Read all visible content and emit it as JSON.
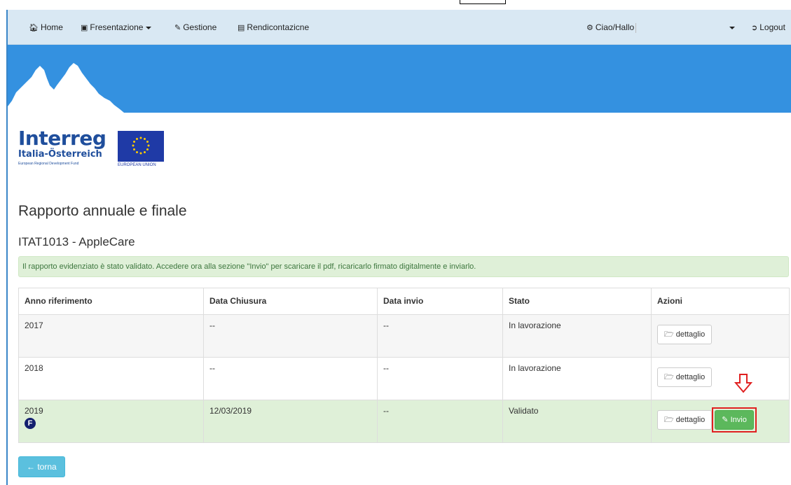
{
  "nav": {
    "home": "Home",
    "presentation": "Fresentazione",
    "management": "Gestione",
    "reporting": "Rendicontazicne",
    "user": "Ciao/Hallo",
    "logout": "Logout"
  },
  "logo": {
    "title": "Interreg",
    "subtitle": "Italia-Österreich",
    "fund": "European Regional Development Fund",
    "eu": "EUROPEAN UNION"
  },
  "page": {
    "title": "Rapporto annuale e finale",
    "project": "ITAT1013 - AppleCare"
  },
  "alert": "Il rapporto evidenziato è stato validato. Accedere ora alla sezione \"Invio\" per scaricare il pdf, ricaricarlo firmato digitalmente e inviarlo.",
  "table": {
    "headers": [
      "Anno riferimento",
      "Data Chiusura",
      "Data invio",
      "Stato",
      "Azioni"
    ],
    "rows": [
      {
        "year": "2017",
        "closing": "--",
        "sent": "--",
        "status": "In lavorazione",
        "detail_label": "dettaglio"
      },
      {
        "year": "2018",
        "closing": "--",
        "sent": "--",
        "status": "In lavorazione",
        "detail_label": "dettaglio"
      },
      {
        "year": "2019",
        "badge": "F",
        "closing": "12/03/2019",
        "sent": "--",
        "status": "Validato",
        "detail_label": "dettaglio",
        "send_label": "Invio"
      }
    ]
  },
  "back_label": "torna",
  "colors": {
    "navbar": "#d9e8f3",
    "banner": "#3491e0",
    "success": "#5cb85c",
    "info": "#5bc0de",
    "highlight": "#e02020",
    "row_validated": "#dff0d8"
  }
}
